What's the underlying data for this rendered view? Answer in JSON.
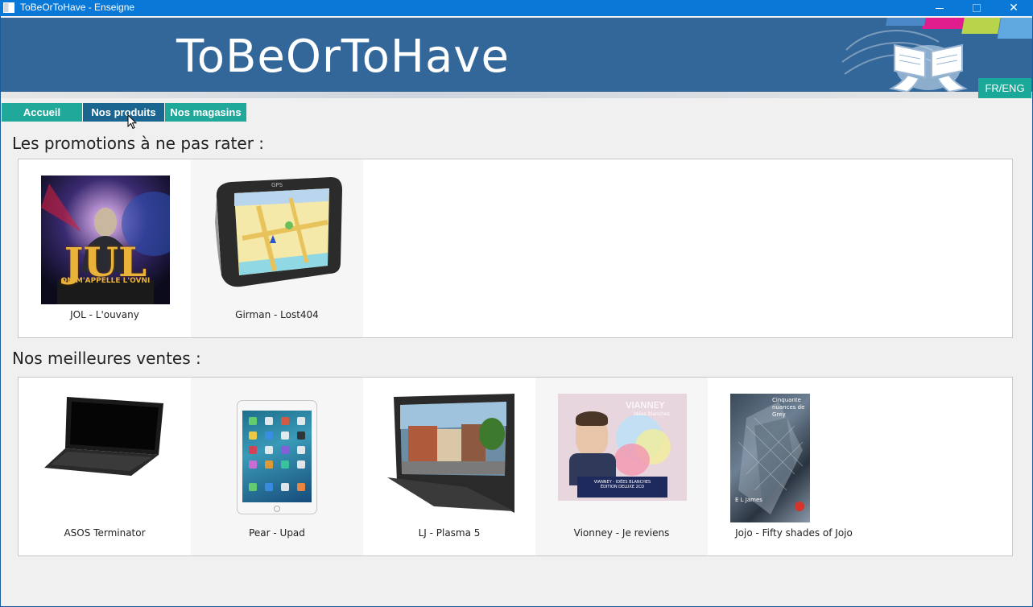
{
  "window": {
    "title": "ToBeOrToHave - Enseigne",
    "close_glyph": "✕"
  },
  "banner": {
    "brand": "ToBeOrToHave",
    "lang_button": "FR/ENG",
    "stripe_colors": [
      "#e11c8c",
      "#9cc23c",
      "#b8d44a",
      "#5fa8e0"
    ]
  },
  "tabs": [
    {
      "label": "Accueil"
    },
    {
      "label": "Nos produits"
    },
    {
      "label": "Nos magasins"
    }
  ],
  "promotions": {
    "title": "Les promotions à ne pas rater :",
    "items": [
      {
        "label": "JOL -  L'ouvany",
        "image": "album-cover-jul"
      },
      {
        "label": "Girman -  Lost404",
        "image": "gps-device"
      }
    ]
  },
  "best_sellers": {
    "title": "Nos meilleures ventes :",
    "items": [
      {
        "label": "ASOS Terminator",
        "image": "laptop"
      },
      {
        "label": "Pear -  Upad",
        "image": "tablet"
      },
      {
        "label": "LJ -  Plasma 5",
        "image": "plasma-tv"
      },
      {
        "label": "Vionney -  Je reviens",
        "image": "album-cover-vianney"
      },
      {
        "label": "Jojo -  Fifty shades of Jojo",
        "image": "book-cover"
      }
    ]
  },
  "album_cover_text": {
    "jul_big": "JUL",
    "jul_small": "ON M'APPELLE L'OVNI",
    "gps_text": "GPS",
    "vianney_name": "VIANNEY",
    "vianney_sub": "idées blanches",
    "vianney_edition": "VIANNEY - IDÉES BLANCHES\nÉDITION DELUXE 2CD",
    "book_title": "Cinquante nuances de Grey",
    "book_author": "E L James"
  },
  "colors": {
    "titlebar": "#0a78d7",
    "banner": "#336699",
    "tab_active": "#1a6690",
    "tab": "#20a89a"
  }
}
